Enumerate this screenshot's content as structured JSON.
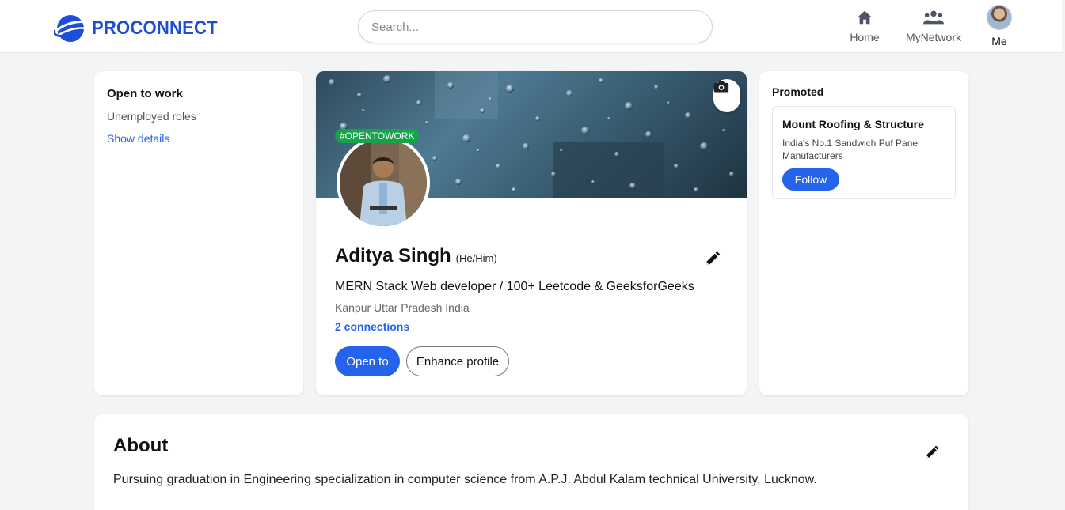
{
  "header": {
    "brand": "PROCONNECT",
    "search_placeholder": "Search...",
    "nav": {
      "home": "Home",
      "network": "MyNetwork",
      "me": "Me"
    }
  },
  "left_card": {
    "title": "Open to work",
    "subtitle": "Unemployed roles",
    "link": "Show details"
  },
  "profile": {
    "badge": "#OPENTOWORK",
    "name": "Aditya Singh",
    "pronouns": "(He/Him)",
    "headline": "MERN Stack Web developer / 100+ Leetcode & GeeksforGeeks",
    "location": "Kanpur Uttar Pradesh India",
    "connections": "2 connections",
    "open_to_label": "Open to",
    "enhance_label": "Enhance profile"
  },
  "promoted": {
    "label": "Promoted",
    "company": "Mount Roofing & Structure",
    "description": "India's No.1 Sandwich Puf Panel Manufacturers",
    "follow_label": "Follow"
  },
  "about": {
    "title": "About",
    "text": "Pursuing graduation in Engineering specialization in computer science from A.P.J. Abdul Kalam technical University, Lucknow."
  },
  "colors": {
    "brand": "#1d4ed8",
    "accent": "#2563eb",
    "badge": "#16a34a",
    "background": "#f3f4f6"
  },
  "icons": [
    "logo-globe-icon",
    "home-icon",
    "network-icon",
    "camera-icon",
    "pencil-icon"
  ]
}
